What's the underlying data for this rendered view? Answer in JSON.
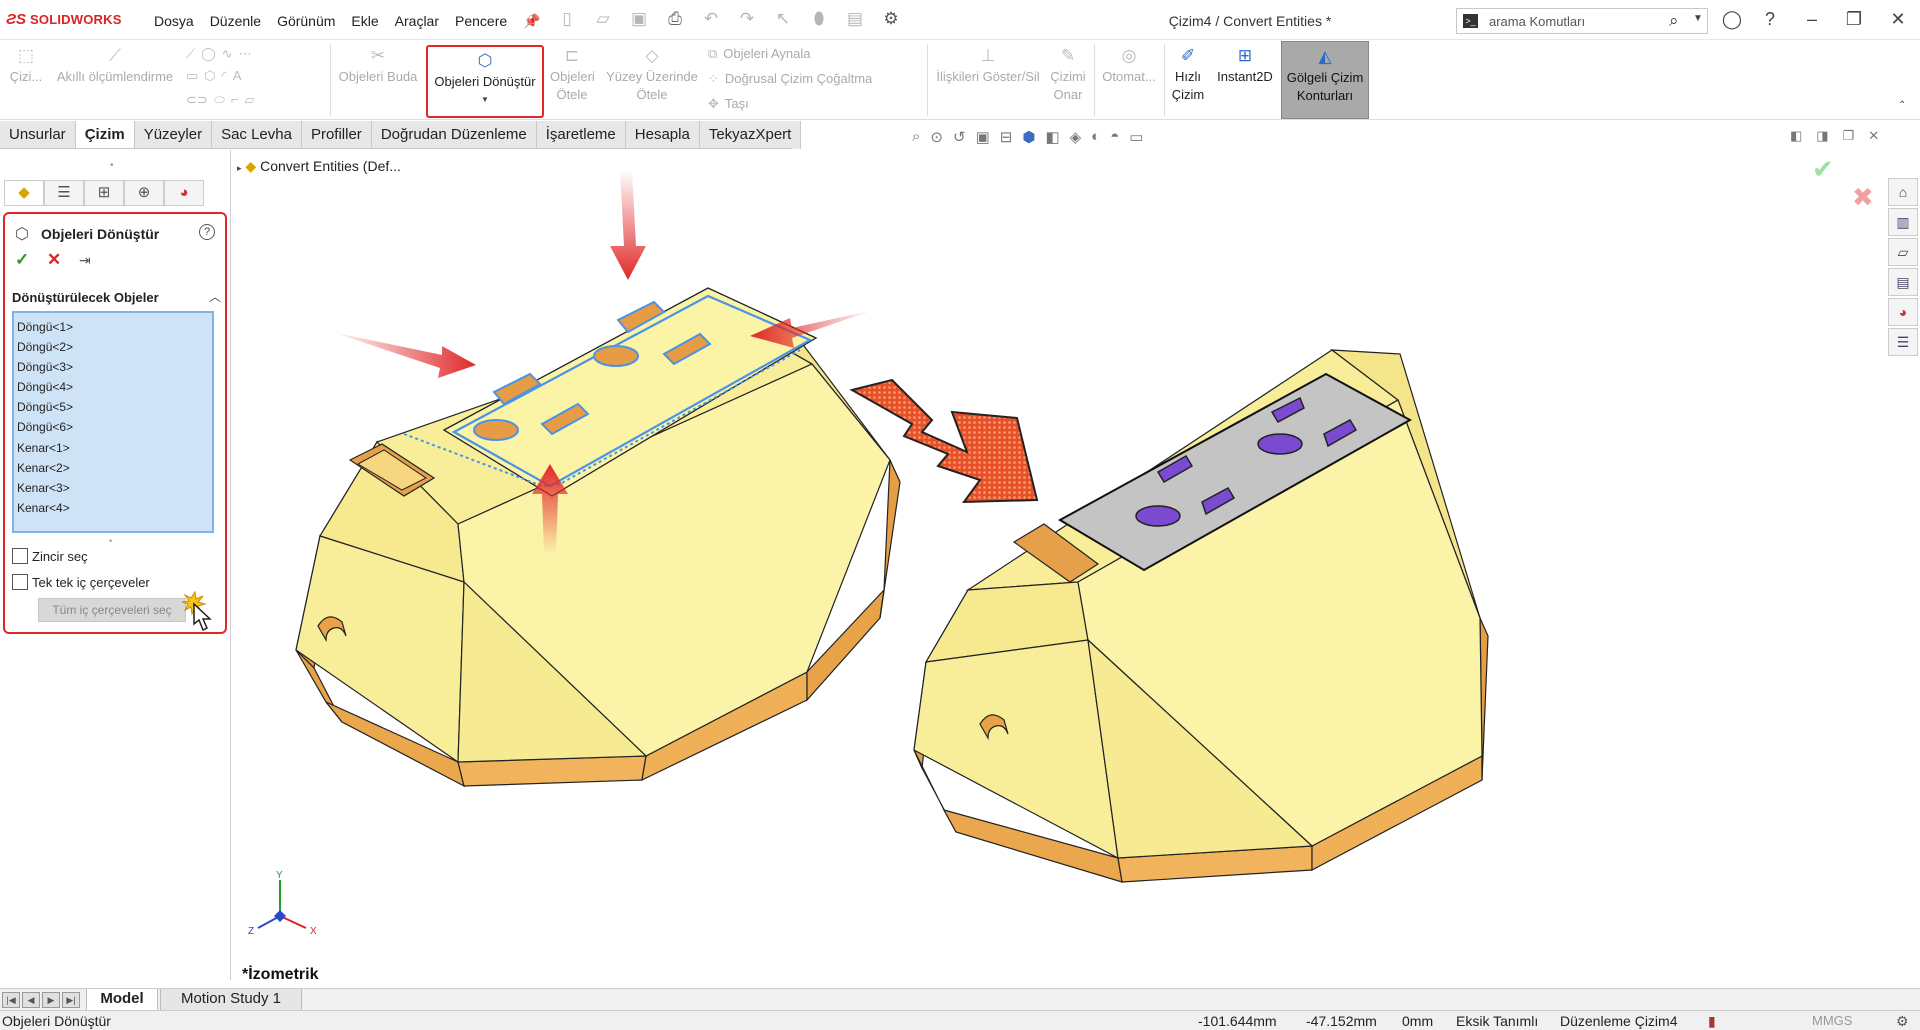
{
  "app": {
    "brand": "SOLIDWORKS",
    "menus": [
      "Dosya",
      "Düzenle",
      "Görünüm",
      "Ekle",
      "Araçlar",
      "Pencere"
    ],
    "document_title": "Çizim4 / Convert Entities *",
    "search_placeholder": "arama Komutları"
  },
  "commands": {
    "sketch": "Çizi...",
    "smart_dimension": "Akıllı ölçümlendirme",
    "trim": "Objeleri Buda",
    "convert_entities": "Objeleri Dönüştür",
    "offset": "Objeleri Ötele",
    "offset_surface": "Yüzey Üzerinde Ötele",
    "mirror": "Objeleri Aynala",
    "linear_pattern": "Doğrusal Çizim Çoğaltma",
    "move": "Taşı",
    "relations": "İlişkileri Göster/Sil",
    "repair": "Çizimi Onar",
    "auto": "Otomat...",
    "rapid_sketch_1": "Hızlı",
    "rapid_sketch_2": "Çizim",
    "instant2d": "Instant2D",
    "shaded_1": "Gölgeli Çizim",
    "shaded_2": "Konturları"
  },
  "tabs": [
    "Unsurlar",
    "Çizim",
    "Yüzeyler",
    "Sac Levha",
    "Profiller",
    "Doğrudan Düzenleme",
    "İşaretleme",
    "Hesapla",
    "TekyazXpert"
  ],
  "active_tab": "Çizim",
  "property_manager": {
    "title": "Objeleri Dönüştür",
    "group_title": "Dönüştürülecek Objeler",
    "selections": [
      "Döngü<1>",
      "Döngü<2>",
      "Döngü<3>",
      "Döngü<4>",
      "Döngü<5>",
      "Döngü<6>",
      "Kenar<1>",
      "Kenar<2>",
      "Kenar<3>",
      "Kenar<4>"
    ],
    "chain_select": "Zincir seç",
    "single_inner": "Tek tek iç çerçeveler",
    "select_all_inner": "Tüm iç çerçeveleri seç"
  },
  "viewport": {
    "tree_node": "Convert Entities (Def...",
    "view_label": "*İzometrik",
    "triad": {
      "x": "X",
      "y": "Y",
      "z": "Z"
    }
  },
  "bottom_tabs": [
    "Model",
    "Motion Study 1"
  ],
  "status": {
    "command": "Objeleri Dönüştür",
    "x": "-101.644mm",
    "y": "-47.152mm",
    "z": "0mm",
    "definition": "Eksik Tanımlı",
    "mode": "Düzenleme Çizim4",
    "units": "MMGS"
  },
  "colors": {
    "accent_red": "#e02828",
    "part_yellow": "#f8ee9a",
    "part_orange": "#e7a24c",
    "selection_blue": "#cfe3f7",
    "converted_purple": "#7a4ad0"
  }
}
